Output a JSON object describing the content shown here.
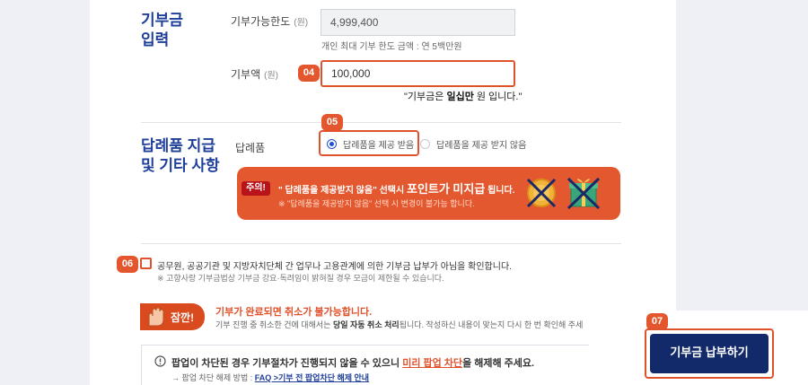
{
  "section_donation": {
    "title_line1": "기부금",
    "title_line2": "입력",
    "limit_label": "기부가능한도",
    "limit_unit": "(원)",
    "limit_value": "4,999,400",
    "limit_hint": "개인 최대 기부 한도 금액 : 연 5백만원",
    "amount_label": "기부액",
    "amount_unit": "(원)",
    "amount_value": "100,000",
    "amount_note_pre": "\"기부금은 ",
    "amount_note_bold": "일십만",
    "amount_note_post": " 원 입니다.\""
  },
  "steps": {
    "s04": "04",
    "s05": "05",
    "s06": "06",
    "s07": "07"
  },
  "section_gift": {
    "title_line1": "답례품 지급",
    "title_line2": "및 기타 사항",
    "gift_label": "답례품",
    "option_receive": "답례품을 제공 받음",
    "option_decline": "답례품을 제공 받지 않음"
  },
  "notice": {
    "tag": "주의!",
    "main_pre": "\" 답례품을 제공받지 않음\" 선택시 ",
    "main_big": "포인트가 미지급",
    "main_post": " 됩니다.",
    "sub": "※ \"답례품을 제공받지 않음\" 선택 시 변경이 불가능 합니다."
  },
  "agree": {
    "text": "공무원, 공공기관 및 지방자치단체 간 업무나 고용관계에 의한 기부금 납부가 아님을 확인합니다.",
    "sub": "※ 고향사랑 기부금법상 기부금 강요·독려임이 밝혀질 경우 모금이 제한될 수 있습니다."
  },
  "warning": {
    "badge": "잠깐!",
    "title": "기부가 완료되면 취소가 불가능합니다.",
    "sub_pre": "기부 진행 중 취소한 건에 대해서는 ",
    "sub_bold": "당일 자동 취소 처리",
    "sub_post": "됩니다. 작성하신 내용이 맞는지 다시 한 번 확인해 주세"
  },
  "popup": {
    "main_pre": "팝업이 차단된 경우 기부절차가 진행되지 않을 수 있으니 ",
    "main_red": "미리 팝업 차단",
    "main_post": "을 해제해 주세요.",
    "sub_pre": "→ 팝업 차단 해제 방법 : ",
    "sub_link": "FAQ >기부 전 팝업차단 해제 안내"
  },
  "submit": {
    "label": "기부금 납부하기"
  },
  "colors": {
    "accent": "#e0522c",
    "navy": "#132a6a",
    "title_blue": "#1f3f99",
    "radio_blue": "#1f4fd8"
  }
}
